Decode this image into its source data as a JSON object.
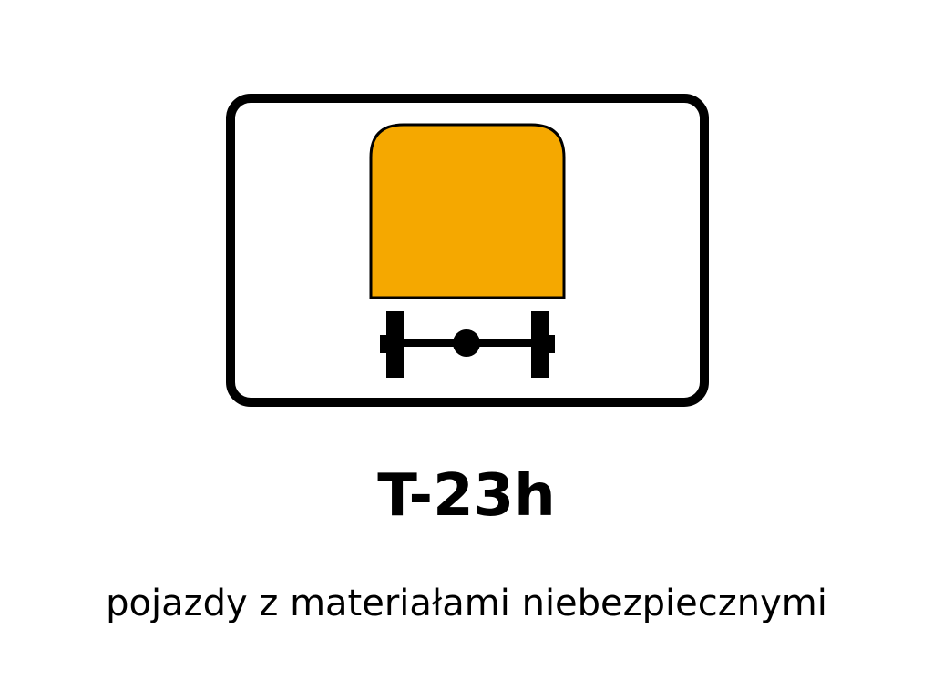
{
  "sign": {
    "code": "T-23h",
    "caption": "pojazdy z materiałami niebezpiecznymi",
    "symbol": "truck-rear-icon",
    "colors": {
      "background": "#ffffff",
      "border": "#000000",
      "cargo": "#f5a800",
      "axle": "#000000"
    }
  }
}
